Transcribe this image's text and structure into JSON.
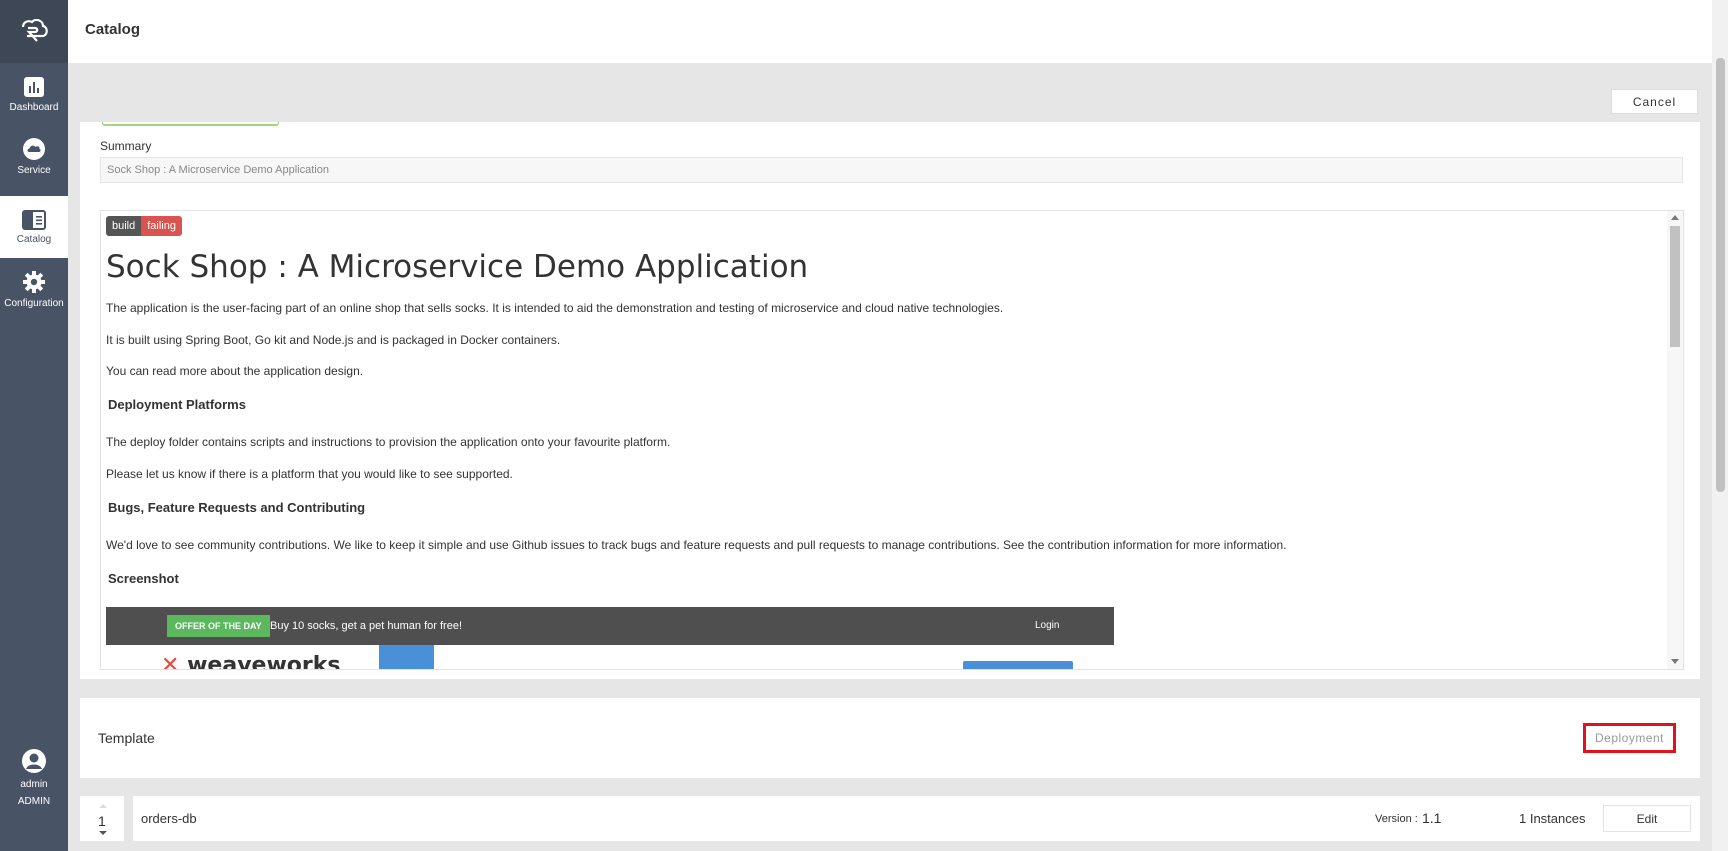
{
  "sidebar": {
    "items": [
      {
        "label": "Dashboard",
        "icon": "chart-icon"
      },
      {
        "label": "Service",
        "icon": "cloud-icon"
      },
      {
        "label": "Catalog",
        "icon": "catalog-icon"
      },
      {
        "label": "Configuration",
        "icon": "gear-icon"
      }
    ],
    "user": {
      "name": "admin",
      "role": "ADMIN"
    }
  },
  "header": {
    "title": "Catalog"
  },
  "toolbar": {
    "cancel_label": "Cancel"
  },
  "summary": {
    "label": "Summary",
    "value": "Sock Shop : A Microservice Demo Application"
  },
  "readme": {
    "badge": {
      "left": "build",
      "right": "failing"
    },
    "title": "Sock Shop : A Microservice Demo Application",
    "p1": "The application is the user-facing part of an online shop that sells socks. It is intended to aid the demonstration and testing of microservice and cloud native technologies.",
    "p2": "It is built using Spring Boot, Go kit and Node.js and is packaged in Docker containers.",
    "p3": "You can read more about the application design.",
    "h_deploy": "Deployment Platforms",
    "p4": "The deploy folder contains scripts and instructions to provision the application onto your favourite platform.",
    "p5": "Please let us know if there is a platform that you would like to see supported.",
    "h_bugs": "Bugs, Feature Requests and Contributing",
    "p6": "We'd love to see community contributions. We like to keep it simple and use Github issues to track bugs and feature requests and pull requests to manage contributions. See the contribution information for more information.",
    "h_screenshot": "Screenshot",
    "screenshot": {
      "offer_badge": "OFFER OF THE DAY",
      "offer_text": "Buy 10 socks, get a pet human for free!",
      "login": "Login",
      "logo_text": "weaveworks"
    }
  },
  "template": {
    "label": "Template",
    "deploy_label": "Deployment"
  },
  "services": [
    {
      "order": "1",
      "name": "orders-db",
      "version_label": "Version :",
      "version": "1.1",
      "instances": "1 Instances",
      "edit_label": "Edit"
    }
  ],
  "colors": {
    "sidebar": "#485465",
    "highlight": "#e0121c",
    "badge_failing": "#d9534f",
    "offer": "#5cb85c"
  }
}
